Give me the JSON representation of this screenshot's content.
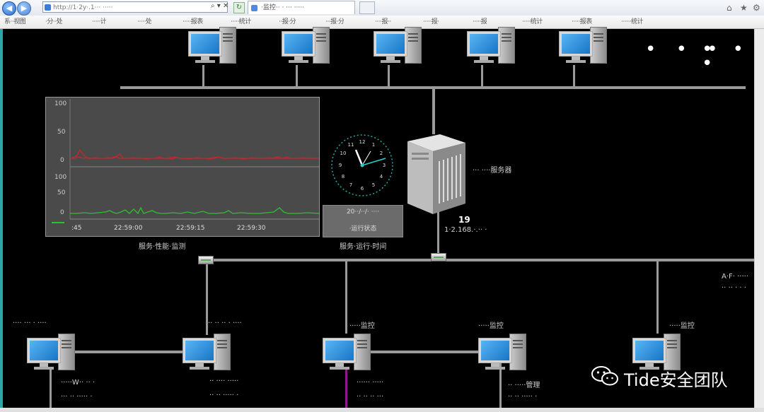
{
  "browser": {
    "address": "http://1·2y·.1··· ·····",
    "tab_title": "·监控·· · ··· ·····",
    "addr_tools": "⌕ ▾ ✕",
    "refresh": "↻",
    "window_icons": [
      "⌂",
      "★",
      "⚙"
    ]
  },
  "menu": {
    "items": [
      "系··视图",
      "·分··处",
      "·····计",
      "·····处",
      "·····报表",
      "·····统计",
      "··报·分",
      "···报·分",
      "····报··",
      "·····报·",
      "·····报",
      "·····统计",
      "·····报表",
      "······统计"
    ]
  },
  "colors": {
    "accent": "#2aa6a6",
    "trend_red": "#c0292c",
    "trend_green": "#2fc02f",
    "line": "#9a9a9a"
  },
  "top_pcs_count": 5,
  "dots": [
    "• • •",
    "• • •"
  ],
  "trend": {
    "upper_axis_ticks": [
      "100",
      "50",
      "0"
    ],
    "lower_axis_ticks": [
      "100",
      "50",
      "0"
    ],
    "x_ticks": [
      ":45",
      "22:59:00",
      "22:59:15",
      "22:59:30"
    ],
    "caption": "服务·性能·监测"
  },
  "clock": {
    "numbers": [
      "12",
      "1",
      "2",
      "3",
      "4",
      "5",
      "6",
      "7",
      "8",
      "9",
      "10",
      "11"
    ],
    "date_text": "20··/··/· ····",
    "status_text": "·运行状态",
    "caption": "服务·运行·时间"
  },
  "server": {
    "name": "··· ····服务器",
    "number": "19",
    "ip": "1·2.168.·.·· ·"
  },
  "right_label": [
    "A·F· ·····",
    "·· ·· · · ·"
  ],
  "bottom_pcs": [
    {
      "top": "···· ··· · ····",
      "lines": [
        "·····W·· ·· ·",
        "··· ·· ····· ·"
      ]
    },
    {
      "top": "·· ·· ·· · ····",
      "lines": [
        "·· ···· ·····",
        "·· ·· ····· ·"
      ]
    },
    {
      "top": "·····监控",
      "lines": [
        "······ ·····",
        "·· ·· ·· ···"
      ]
    },
    {
      "top": "·····监控",
      "lines": [
        "·· ·····管理",
        "·· ·· ····· ·"
      ]
    },
    {
      "top": "·····监控",
      "lines": [
        "",
        ""
      ]
    }
  ],
  "watermark": {
    "text": "Tide安全团队",
    "icon": "wechat-icon"
  }
}
